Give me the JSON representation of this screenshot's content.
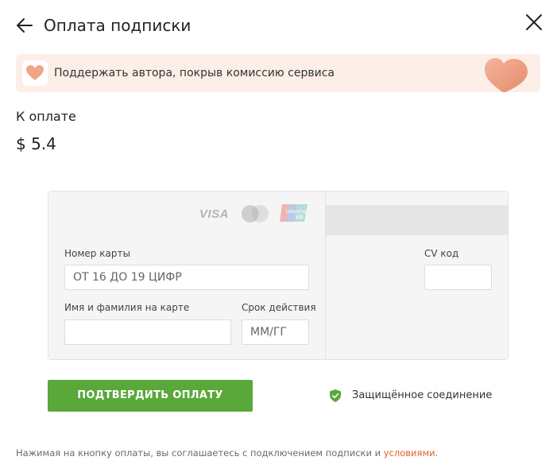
{
  "header": {
    "title": "Оплата подписки"
  },
  "support_banner": {
    "text": "Поддержать автора, покрыв комиссию сервиса",
    "accent_color": "#fdeee8",
    "heart_color": "#f0a58a"
  },
  "amount": {
    "label": "К оплате",
    "value": "$ 5.4"
  },
  "card_form": {
    "logos": {
      "visa": "VISA",
      "mastercard": "mastercard-logo",
      "unionpay": "unionpay-logo"
    },
    "card_number": {
      "label": "Номер карты",
      "placeholder": "ОТ 16 ДО 19 ЦИФР",
      "value": ""
    },
    "cardholder": {
      "label": "Имя и фамилия на карте",
      "placeholder": "",
      "value": ""
    },
    "expiry": {
      "label": "Срок действия",
      "placeholder": "ММ/ГГ",
      "value": ""
    },
    "cvv": {
      "label": "CV код",
      "placeholder": "",
      "value": ""
    }
  },
  "pay_button": {
    "label": "ПОДТВЕРДИТЬ ОПЛАТУ",
    "color": "#5aa83a"
  },
  "secure": {
    "text": "Защищённое соединение",
    "icon": "shield-check-icon",
    "color": "#5aa83a"
  },
  "footer": {
    "text": "Нажимая на кнопку оплаты, вы соглашаетесь с подключением подписки и ",
    "link_text": "условиями",
    "suffix": ".",
    "link_color": "#e0622c"
  }
}
